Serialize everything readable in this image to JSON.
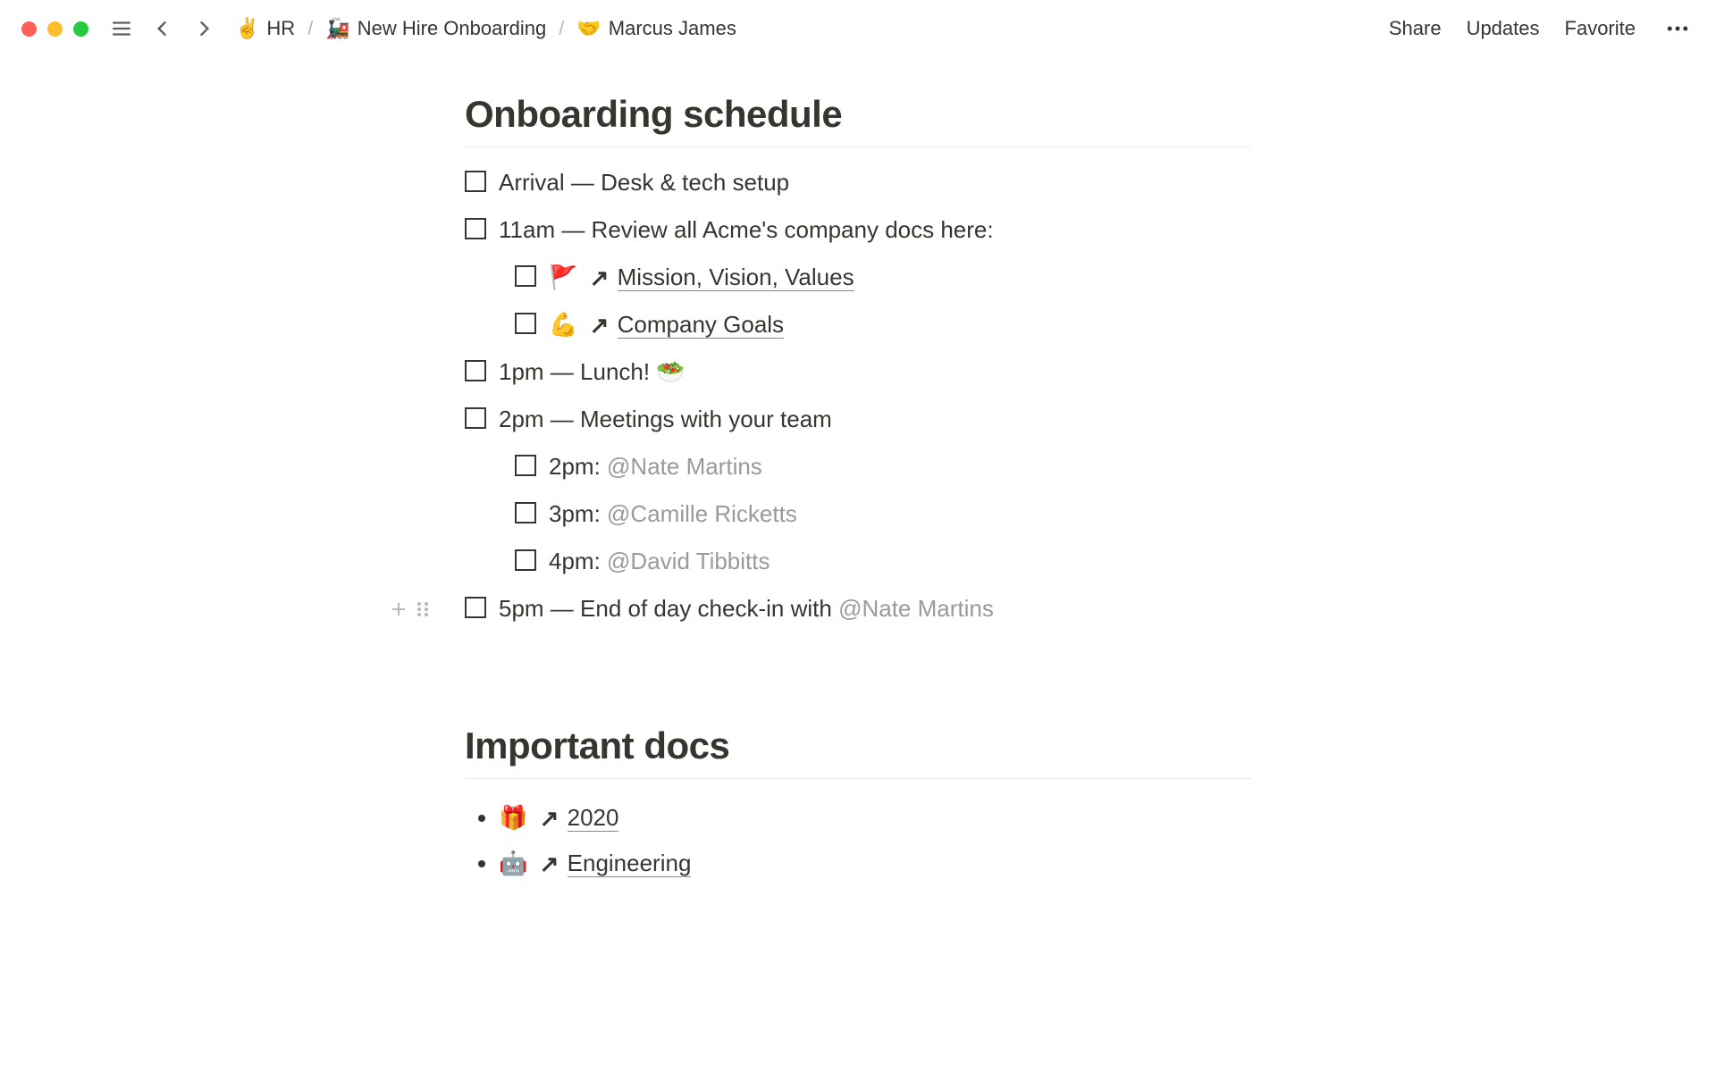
{
  "topbar": {
    "breadcrumb": [
      {
        "emoji": "✌️",
        "label": "HR"
      },
      {
        "emoji": "🚂",
        "label": "New Hire Onboarding"
      },
      {
        "emoji": "🤝",
        "label": "Marcus James"
      }
    ],
    "actions": {
      "share": "Share",
      "updates": "Updates",
      "favorite": "Favorite"
    }
  },
  "sections": {
    "onboarding_title": "Onboarding schedule",
    "docs_title": "Important docs"
  },
  "todos": {
    "t0": "Arrival — Desk & tech setup",
    "t1": "11am — Review all Acme's company docs here:",
    "t1a_emoji": "🚩",
    "t1a_link": "Mission, Vision, Values",
    "t1b_emoji": "💪",
    "t1b_link": "Company Goals",
    "t2": "1pm — Lunch! 🥗",
    "t3": "2pm — Meetings with your team",
    "t3a_time": "2pm: ",
    "t3a_mention": "@Nate Martins",
    "t3b_time": "3pm: ",
    "t3b_mention": "@Camille Ricketts",
    "t3c_time": "4pm: ",
    "t3c_mention": "@David Tibbitts",
    "t4_prefix": "5pm — End of day check-in with ",
    "t4_mention": "@Nate Martins"
  },
  "docs": {
    "d0_emoji": "🎁",
    "d0_link": "2020",
    "d1_emoji": "🤖",
    "d1_link": "Engineering"
  }
}
